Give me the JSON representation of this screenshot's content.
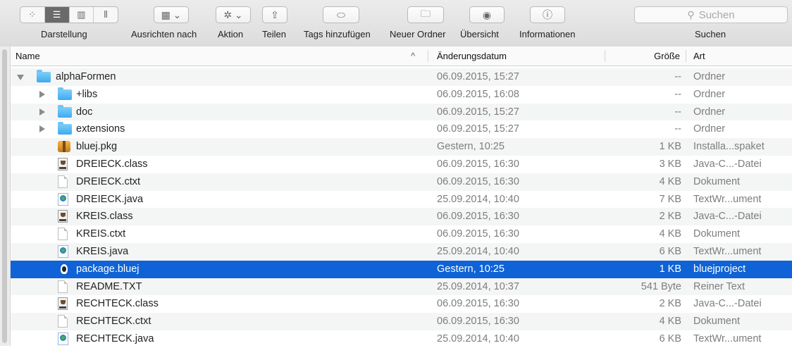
{
  "toolbar": {
    "labels": {
      "view": "Darstellung",
      "arrange": "Ausrichten nach",
      "action": "Aktion",
      "share": "Teilen",
      "tags": "Tags hinzufügen",
      "new_folder": "Neuer Ordner",
      "overview": "Übersicht",
      "info": "Informationen",
      "search": "Suchen"
    },
    "search_placeholder": "Suchen"
  },
  "columns": {
    "name": "Name",
    "modified": "Änderungsdatum",
    "size": "Größe",
    "kind": "Art"
  },
  "colors": {
    "selection": "#0f63d6",
    "folder": "#5bbdf4"
  },
  "rows": [
    {
      "name": "alphaFormen",
      "modified": "06.09.2015, 15:27",
      "size": "--",
      "kind": "Ordner",
      "icon": "folder-icon",
      "level": 0,
      "disclosure": "open"
    },
    {
      "name": "+libs",
      "modified": "06.09.2015, 16:08",
      "size": "--",
      "kind": "Ordner",
      "icon": "folder-icon",
      "level": 1,
      "disclosure": "closed"
    },
    {
      "name": "doc",
      "modified": "06.09.2015, 15:27",
      "size": "--",
      "kind": "Ordner",
      "icon": "folder-icon",
      "level": 1,
      "disclosure": "closed"
    },
    {
      "name": "extensions",
      "modified": "06.09.2015, 15:27",
      "size": "--",
      "kind": "Ordner",
      "icon": "folder-icon",
      "level": 1,
      "disclosure": "closed"
    },
    {
      "name": "bluej.pkg",
      "modified": "Gestern, 10:25",
      "size": "1 KB",
      "kind": "Installa...spaket",
      "icon": "package-icon",
      "level": 1
    },
    {
      "name": "DREIECK.class",
      "modified": "06.09.2015, 16:30",
      "size": "3 KB",
      "kind": "Java-C...-Datei",
      "icon": "class-file-icon",
      "level": 1
    },
    {
      "name": "DREIECK.ctxt",
      "modified": "06.09.2015, 16:30",
      "size": "4 KB",
      "kind": "Dokument",
      "icon": "document-icon",
      "level": 1
    },
    {
      "name": "DREIECK.java",
      "modified": "25.09.2014, 10:40",
      "size": "7 KB",
      "kind": "TextWr...ument",
      "icon": "java-file-icon",
      "level": 1
    },
    {
      "name": "KREIS.class",
      "modified": "06.09.2015, 16:30",
      "size": "2 KB",
      "kind": "Java-C...-Datei",
      "icon": "class-file-icon",
      "level": 1
    },
    {
      "name": "KREIS.ctxt",
      "modified": "06.09.2015, 16:30",
      "size": "4 KB",
      "kind": "Dokument",
      "icon": "document-icon",
      "level": 1
    },
    {
      "name": "KREIS.java",
      "modified": "25.09.2014, 10:40",
      "size": "6 KB",
      "kind": "TextWr...ument",
      "icon": "java-file-icon",
      "level": 1
    },
    {
      "name": "package.bluej",
      "modified": "Gestern, 10:25",
      "size": "1 KB",
      "kind": "bluejproject",
      "icon": "bluej-icon",
      "level": 1,
      "selected": true
    },
    {
      "name": "README.TXT",
      "modified": "25.09.2014, 10:37",
      "size": "541 Byte",
      "kind": "Reiner Text",
      "icon": "document-icon",
      "level": 1
    },
    {
      "name": "RECHTECK.class",
      "modified": "06.09.2015, 16:30",
      "size": "2 KB",
      "kind": "Java-C...-Datei",
      "icon": "class-file-icon",
      "level": 1
    },
    {
      "name": "RECHTECK.ctxt",
      "modified": "06.09.2015, 16:30",
      "size": "4 KB",
      "kind": "Dokument",
      "icon": "document-icon",
      "level": 1
    },
    {
      "name": "RECHTECK.java",
      "modified": "25.09.2014, 10:40",
      "size": "6 KB",
      "kind": "TextWr...ument",
      "icon": "java-file-icon",
      "level": 1
    }
  ]
}
